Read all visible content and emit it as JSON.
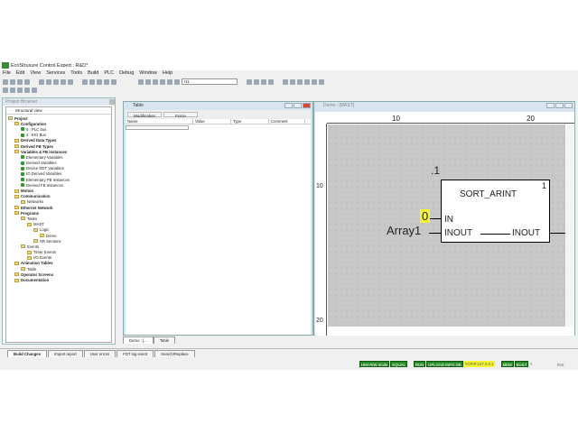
{
  "window_title": "EcoStruxure Control Expert : R&D*",
  "menu": [
    "File",
    "Edit",
    "View",
    "Services",
    "Tools",
    "Build",
    "PLC",
    "Debug",
    "Window",
    "Help"
  ],
  "toolbar_combo": "H1",
  "project_browser": {
    "title": "Project Browser",
    "view": "Structural view",
    "items": [
      {
        "label": "Project",
        "level": 0,
        "bold": true,
        "icon": "folder"
      },
      {
        "label": "Configuration",
        "level": 1,
        "bold": true,
        "icon": "folder"
      },
      {
        "label": "0 : PLC bus",
        "level": 2,
        "bold": false,
        "icon": "bus"
      },
      {
        "label": "2 : EIO Bus",
        "level": 2,
        "bold": false,
        "icon": "bus"
      },
      {
        "label": "Derived Data Types",
        "level": 1,
        "bold": true,
        "icon": "folder"
      },
      {
        "label": "Derived FB Types",
        "level": 1,
        "bold": true,
        "icon": "folder"
      },
      {
        "label": "Variables & FB instances",
        "level": 1,
        "bold": true,
        "icon": "folder"
      },
      {
        "label": "Elementary Variables",
        "level": 2,
        "bold": false,
        "icon": "var"
      },
      {
        "label": "Derived Variables",
        "level": 2,
        "bold": false,
        "icon": "var"
      },
      {
        "label": "Device DDT Variables",
        "level": 2,
        "bold": false,
        "icon": "var"
      },
      {
        "label": "IO Derived Variables",
        "level": 2,
        "bold": false,
        "icon": "var"
      },
      {
        "label": "Elementary FB Instances",
        "level": 2,
        "bold": false,
        "icon": "var"
      },
      {
        "label": "Derived FB Instances",
        "level": 2,
        "bold": false,
        "icon": "var"
      },
      {
        "label": "Motion",
        "level": 1,
        "bold": true,
        "icon": "folder"
      },
      {
        "label": "Communication",
        "level": 1,
        "bold": true,
        "icon": "folder"
      },
      {
        "label": "Networks",
        "level": 2,
        "bold": false,
        "icon": "folder"
      },
      {
        "label": "Ethernet Network",
        "level": 1,
        "bold": true,
        "icon": "net"
      },
      {
        "label": "Programs",
        "level": 1,
        "bold": true,
        "icon": "folder"
      },
      {
        "label": "Tasks",
        "level": 2,
        "bold": false,
        "icon": "folder"
      },
      {
        "label": "MAST",
        "level": 3,
        "bold": false,
        "icon": "folder"
      },
      {
        "label": "Logic",
        "level": 4,
        "bold": false,
        "icon": "folder"
      },
      {
        "label": "Demo",
        "level": 5,
        "bold": false,
        "icon": "section"
      },
      {
        "label": "SR Sections",
        "level": 4,
        "bold": false,
        "icon": "folder"
      },
      {
        "label": "Events",
        "level": 2,
        "bold": false,
        "icon": "folder"
      },
      {
        "label": "Timer Events",
        "level": 3,
        "bold": false,
        "icon": "folder"
      },
      {
        "label": "I/O Events",
        "level": 3,
        "bold": false,
        "icon": "folder"
      },
      {
        "label": "Animation Tables",
        "level": 1,
        "bold": true,
        "icon": "folder"
      },
      {
        "label": "Table",
        "level": 2,
        "bold": false,
        "icon": "table"
      },
      {
        "label": "Operator Screens",
        "level": 1,
        "bold": true,
        "icon": "folder"
      },
      {
        "label": "Documentation",
        "level": 1,
        "bold": true,
        "icon": "doc"
      }
    ]
  },
  "table_window": {
    "title": "Table",
    "modification": "Modification",
    "force": "Force",
    "columns": [
      "Name",
      "Value",
      "Type",
      "Comment"
    ]
  },
  "demo_window": {
    "title": "Demo : [MAST]",
    "ruler_top": [
      "10",
      "20"
    ],
    "ruler_left": [
      "10",
      "20"
    ],
    "block": {
      "instance": ".1",
      "name": "SORT_ARINT",
      "number": "1",
      "pins_in": [
        "IN",
        "INOUT"
      ],
      "pin_out": "INOUT",
      "in_value": "0",
      "inout_var": "Array1"
    }
  },
  "doc_tabs": [
    "Demo : [...",
    "Table"
  ],
  "output_tabs": [
    "Build Changes",
    "Import report",
    "User errors",
    "FDT log event",
    "Search/Replace"
  ],
  "status": {
    "items": [
      "HMI R/W mode",
      "EQUAL",
      "RUN",
      "UPLOAD INFO OK",
      "TCPIP:127.0.0.1",
      "MEM",
      "BUILT"
    ],
    "ins": "INS",
    "accent": "#2a8a2a",
    "highlight": "#f4f430"
  }
}
